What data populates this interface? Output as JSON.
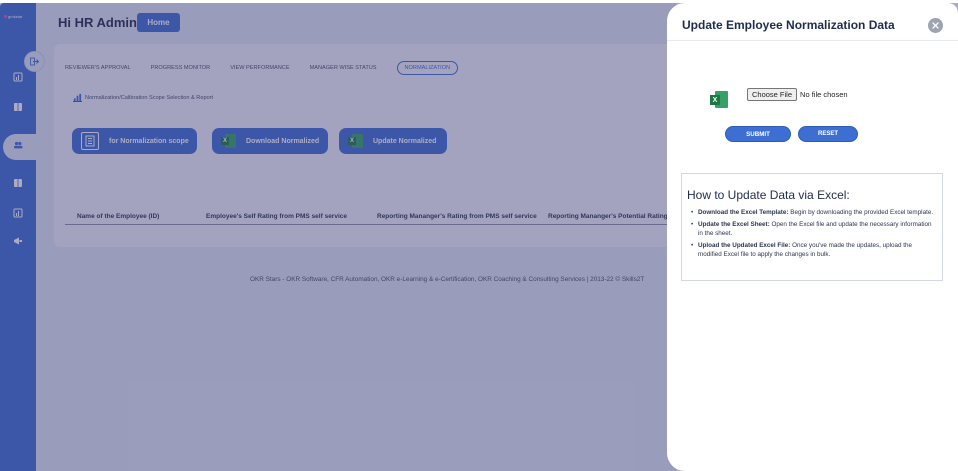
{
  "header": {
    "greeting": "Hi HR Admin",
    "home_label": "Home"
  },
  "sidebar": {
    "logo_text": "grokstar",
    "icons": [
      "dashboard-icon",
      "book-icon",
      "users-icon",
      "book-icon",
      "report-icon",
      "megaphone-icon"
    ]
  },
  "tabs": [
    {
      "label": "REVIEWER'S APPROVAL"
    },
    {
      "label": "PROGRESS MONITOR"
    },
    {
      "label": "VIEW PERFORMANCE"
    },
    {
      "label": "MANAGER WISE STATUS"
    },
    {
      "label": "NORMALIZATION",
      "active": true
    }
  ],
  "scope_title": "Normalization/Calibration Scope Selection & Report",
  "actions": {
    "scope_label": "for Normalization scope",
    "download_label": "Download Normalized",
    "update_label": "Update Normalized"
  },
  "table": {
    "columns": [
      "Name of the Employee (ID)",
      "Employee's Self Rating from PMS self service",
      "Reporting Mananger's Rating from PMS self service",
      "Reporting Mananger's Potential Rating Grid) for Talent Management"
    ]
  },
  "footer": "OKR Stars - OKR Software, CFR Automation, OKR e-Learning & e-Certification, OKR Coaching & Consulting Services | 2013-22 © Skills2T",
  "panel": {
    "title": "Update Employee Normalization Data",
    "choose_file_label": "Choose File",
    "no_file_label": "No file chosen",
    "submit_label": "SUBMIT",
    "reset_label": "RESET",
    "howto_title": "How to Update Data via Excel:",
    "steps": [
      {
        "title": "Download the Excel Template:",
        "text": "Begin by downloading the provided Excel template."
      },
      {
        "title": "Update the Excel Sheet:",
        "text": "Open the Excel file and update the necessary information in the sheet."
      },
      {
        "title": "Upload the Updated Excel File:",
        "text": "Once you've made the updates, upload the modified Excel file to apply the changes in bulk."
      }
    ]
  },
  "colors": {
    "brand": "#3d6fd3",
    "overlay": "#3c386e",
    "excel_green": "#1e7a45"
  }
}
